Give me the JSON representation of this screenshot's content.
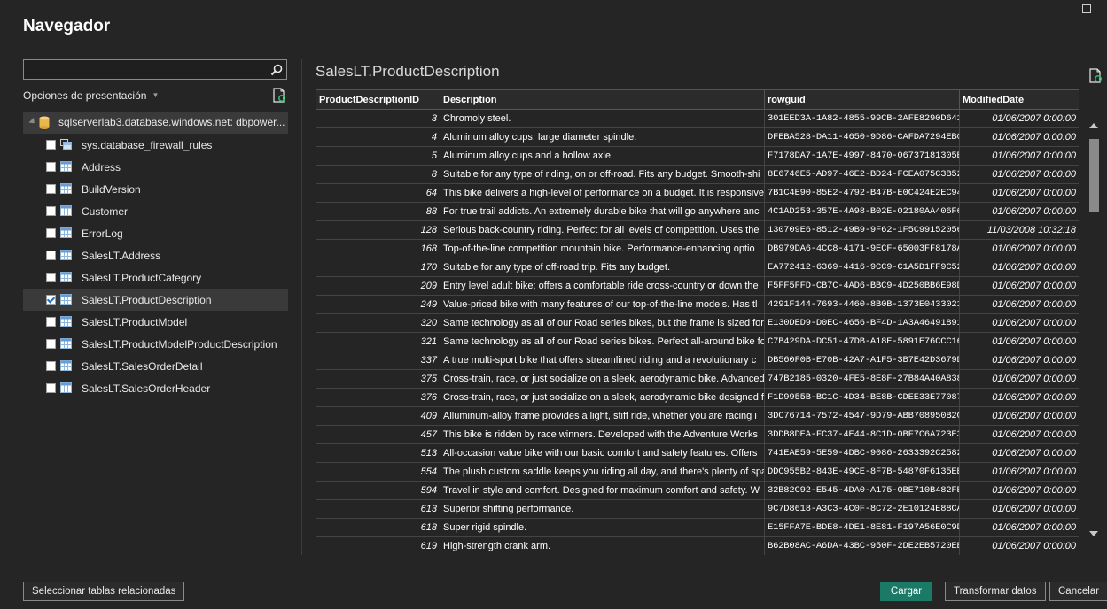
{
  "window": {
    "title": "Navegador"
  },
  "left": {
    "search": {
      "value": "",
      "placeholder": ""
    },
    "display_options": "Opciones de presentación",
    "server": "sqlserverlab3.database.windows.net: dbpower...",
    "items": [
      {
        "label": "sys.database_firewall_rules",
        "checked": false,
        "icon": "view-icon"
      },
      {
        "label": "Address",
        "checked": false,
        "icon": "table-icon"
      },
      {
        "label": "BuildVersion",
        "checked": false,
        "icon": "table-icon"
      },
      {
        "label": "Customer",
        "checked": false,
        "icon": "table-icon"
      },
      {
        "label": "ErrorLog",
        "checked": false,
        "icon": "table-icon"
      },
      {
        "label": "SalesLT.Address",
        "checked": false,
        "icon": "table-icon"
      },
      {
        "label": "SalesLT.ProductCategory",
        "checked": false,
        "icon": "table-icon"
      },
      {
        "label": "SalesLT.ProductDescription",
        "checked": true,
        "icon": "table-icon"
      },
      {
        "label": "SalesLT.ProductModel",
        "checked": false,
        "icon": "table-icon"
      },
      {
        "label": "SalesLT.ProductModelProductDescription",
        "checked": false,
        "icon": "table-icon"
      },
      {
        "label": "SalesLT.SalesOrderDetail",
        "checked": false,
        "icon": "table-icon"
      },
      {
        "label": "SalesLT.SalesOrderHeader",
        "checked": false,
        "icon": "table-icon"
      }
    ]
  },
  "preview": {
    "title": "SalesLT.ProductDescription",
    "columns": [
      "ProductDescriptionID",
      "Description",
      "rowguid",
      "ModifiedDate"
    ],
    "rows": [
      [
        "3",
        "Chromoly steel.",
        "301EED3A-1A82-4855-99CB-2AFE8290D641",
        "01/06/2007 0:00:00"
      ],
      [
        "4",
        "Aluminum alloy cups; large diameter spindle.",
        "DFEBA528-DA11-4650-9D86-CAFDA7294EB0",
        "01/06/2007 0:00:00"
      ],
      [
        "5",
        "Aluminum alloy cups and a hollow axle.",
        "F7178DA7-1A7E-4997-8470-06737181305E",
        "01/06/2007 0:00:00"
      ],
      [
        "8",
        "Suitable for any type of riding, on or off-road. Fits any budget. Smooth-shi",
        "8E6746E5-AD97-46E2-BD24-FCEA075C3B52",
        "01/06/2007 0:00:00"
      ],
      [
        "64",
        "This bike delivers a high-level of performance on a budget. It is responsive",
        "7B1C4E90-85E2-4792-B47B-E0C424E2EC94",
        "01/06/2007 0:00:00"
      ],
      [
        "88",
        "For true trail addicts. An extremely durable bike that will go anywhere anc",
        "4C1AD253-357E-4A98-B02E-02180AA406F6",
        "01/06/2007 0:00:00"
      ],
      [
        "128",
        "Serious back-country riding. Perfect for all levels of competition. Uses the",
        "130709E6-8512-49B9-9F62-1F5C99152056",
        "11/03/2008 10:32:18"
      ],
      [
        "168",
        "Top-of-the-line competition mountain bike. Performance-enhancing optio",
        "DB979DA6-4CC8-4171-9ECF-65003FF8178A",
        "01/06/2007 0:00:00"
      ],
      [
        "170",
        "Suitable for any type of off-road trip. Fits any budget.",
        "EA772412-6369-4416-9CC9-C1A5D1FF9C52",
        "01/06/2007 0:00:00"
      ],
      [
        "209",
        "Entry level adult bike; offers a comfortable ride cross-country or down the",
        "F5FF5FFD-CB7C-4AD6-BBC9-4D250BB6E98D",
        "01/06/2007 0:00:00"
      ],
      [
        "249",
        "Value-priced bike with many features of our top-of-the-line models. Has tl",
        "4291F144-7693-4460-8B0B-1373E0433021",
        "01/06/2007 0:00:00"
      ],
      [
        "320",
        "Same technology as all of our Road series bikes, but the frame is sized for",
        "E130DED9-D0EC-4656-BF4D-1A3A46491891",
        "01/06/2007 0:00:00"
      ],
      [
        "321",
        "Same technology as all of our Road series bikes. Perfect all-around bike fo",
        "C7B429DA-DC51-47DB-A18E-5891E76CCC16",
        "01/06/2007 0:00:00"
      ],
      [
        "337",
        "A true multi-sport bike that offers streamlined riding and a revolutionary c",
        "DB560F0B-E70B-42A7-A1F5-3B7E42D3679D",
        "01/06/2007 0:00:00"
      ],
      [
        "375",
        "Cross-train, race, or just socialize on a sleek, aerodynamic bike. Advanced",
        "747B2185-0320-4FE5-8E8F-27B84A40A838",
        "01/06/2007 0:00:00"
      ],
      [
        "376",
        "Cross-train, race, or just socialize on a sleek, aerodynamic bike designed fc",
        "F1D9955B-BC1C-4D34-BE8B-CDEE33E77087",
        "01/06/2007 0:00:00"
      ],
      [
        "409",
        "Alluminum-alloy frame provides a light, stiff ride, whether you are racing i",
        "3DC76714-7572-4547-9D79-ABB708950B2C",
        "01/06/2007 0:00:00"
      ],
      [
        "457",
        "This bike is ridden by race winners. Developed with the Adventure Works",
        "3DDB8DEA-FC37-4E44-8C1D-0BF7C6A723E3",
        "01/06/2007 0:00:00"
      ],
      [
        "513",
        "All-occasion value bike with our basic comfort and safety features. Offers",
        "741EAE59-5E59-4DBC-9086-2633392C2582",
        "01/06/2007 0:00:00"
      ],
      [
        "554",
        "The plush custom saddle keeps you riding all day, and there's plenty of spa",
        "DDC955B2-843E-49CE-8F7B-54870F6135EB",
        "01/06/2007 0:00:00"
      ],
      [
        "594",
        "Travel in style and comfort. Designed for maximum comfort and safety. W",
        "32B82C92-E545-4DA0-A175-0BE710B482FE",
        "01/06/2007 0:00:00"
      ],
      [
        "613",
        "Superior shifting performance.",
        "9C7D8618-A3C3-4C0F-8C72-2E10124E88CA",
        "01/06/2007 0:00:00"
      ],
      [
        "618",
        "Super rigid spindle.",
        "E15FFA7E-BDE8-4DE1-8E81-F197A56E0C9D",
        "01/06/2007 0:00:00"
      ],
      [
        "619",
        "High-strength crank arm.",
        "B62B08AC-A6DA-43BC-950F-2DE2EB5720EB",
        "01/06/2007 0:00:00"
      ]
    ]
  },
  "footer": {
    "related": "Seleccionar tablas relacionadas",
    "load": "Cargar",
    "transform": "Transformar datos",
    "cancel": "Cancelar"
  },
  "colors": {
    "background": "#252526",
    "primary_button": "#1a7a66",
    "selected_row": "#3a3a3a"
  }
}
